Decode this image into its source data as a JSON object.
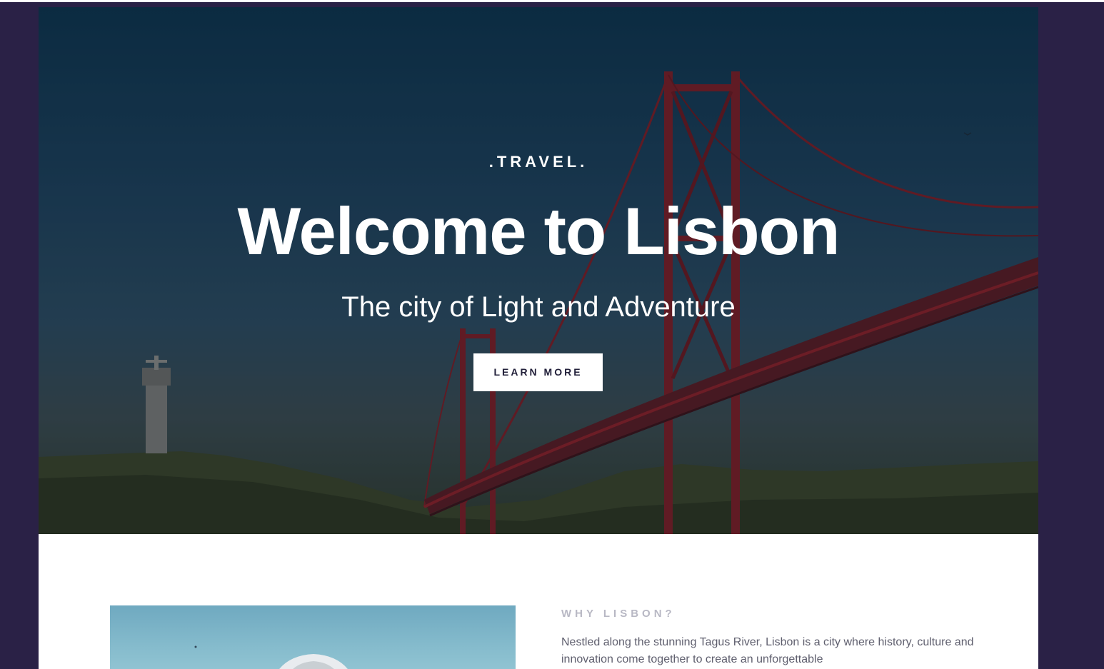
{
  "hero": {
    "eyebrow": ".TRAVEL.",
    "headline": "Welcome to Lisbon",
    "subheadline": "The city of Light and Adventure",
    "cta_label": "LEARN MORE"
  },
  "intro": {
    "label": "WHY LISBON?",
    "text": "Nestled along the stunning Tagus River, Lisbon is a city where history, culture and innovation come together to create an unforgettable"
  },
  "colors": {
    "frame_background": "#2a2146",
    "page_background": "#ffffff",
    "button_background": "#ffffff",
    "button_text": "#22203a",
    "label_color": "#b8b8c4",
    "body_text_color": "#5f5f6e",
    "bridge_red": "#8c1f24"
  }
}
